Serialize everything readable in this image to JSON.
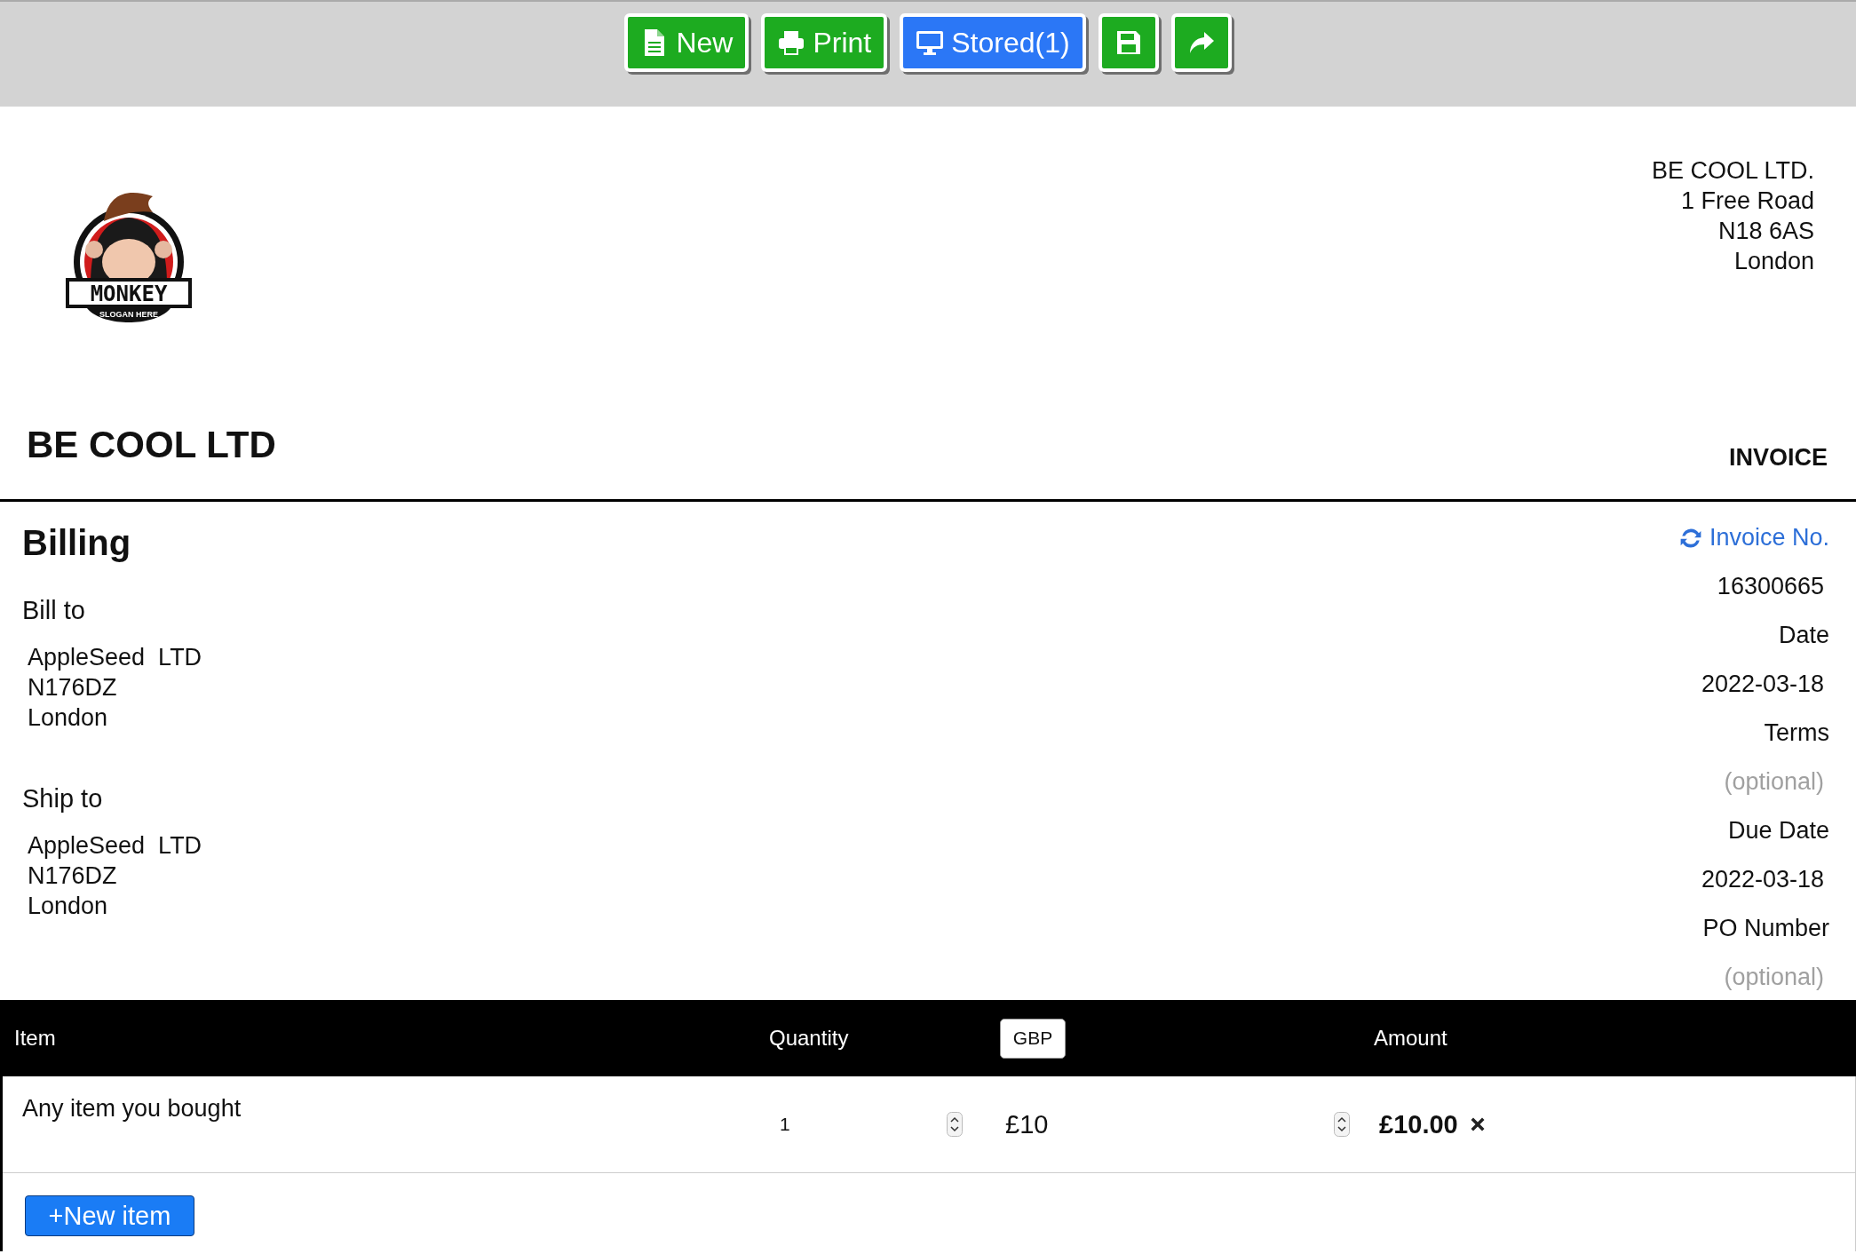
{
  "toolbar": {
    "buttons": [
      {
        "kind": "new",
        "label": "New",
        "color": "#1dab20"
      },
      {
        "kind": "print",
        "label": "Print",
        "color": "#1dab20"
      },
      {
        "kind": "stored",
        "label": "Stored(1)",
        "color": "#2b77f6"
      },
      {
        "kind": "save",
        "color": "#1dab20"
      },
      {
        "kind": "share",
        "color": "#1dab20"
      }
    ]
  },
  "logo": {
    "title": "MONKEY",
    "slogan": "SLOGAN HERE"
  },
  "company_address": [
    "BE COOL LTD.",
    "1 Free Road",
    "N18 6AS",
    "London"
  ],
  "company_name": "BE COOL LTD",
  "document_title": "INVOICE",
  "billing": {
    "heading": "Billing",
    "sections": [
      {
        "label": "Bill to",
        "lines": [
          "AppleSeed  LTD",
          "N176DZ",
          "London"
        ]
      },
      {
        "label": "Ship to",
        "lines": [
          "AppleSeed  LTD",
          "N176DZ",
          "London"
        ]
      }
    ]
  },
  "details": [
    {
      "kind": "link",
      "label": "Invoice No.",
      "value": "16300665"
    },
    {
      "kind": "field",
      "label": "Date",
      "value": "2022-03-18"
    },
    {
      "kind": "field",
      "label": "Terms",
      "placeholder": "(optional)"
    },
    {
      "kind": "field",
      "label": "Due Date",
      "value": "2022-03-18"
    },
    {
      "kind": "field",
      "label": "PO Number",
      "placeholder": "(optional)"
    }
  ],
  "table": {
    "columns": [
      {
        "kind": "text",
        "label": "Item"
      },
      {
        "kind": "text",
        "label": "Quantity"
      },
      {
        "kind": "select",
        "label": "GBP"
      },
      {
        "kind": "text",
        "label": "Amount"
      }
    ],
    "rows": [
      {
        "item": "Any item you bought",
        "quantity": "1",
        "currency": "£",
        "price": "10",
        "amount": "£10.00"
      }
    ]
  },
  "add_button": {
    "label": "+New item"
  }
}
